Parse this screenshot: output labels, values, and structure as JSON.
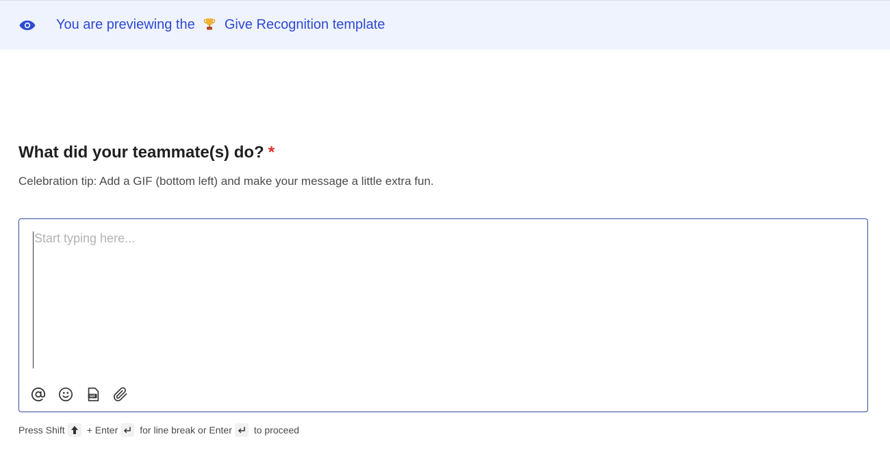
{
  "banner": {
    "prefix": "You are previewing the",
    "template_name": "Give Recognition template",
    "icon": "eye-icon",
    "trophy_icon": "trophy-icon"
  },
  "question": {
    "title": "What did your teammate(s) do?",
    "required_mark": "*",
    "hint": "Celebration tip: Add a GIF (bottom left) and make your message a little extra fun."
  },
  "editor": {
    "placeholder": "Start typing here...",
    "value": "",
    "toolbar": [
      {
        "name": "mention",
        "icon": "at-sign-icon"
      },
      {
        "name": "emoji",
        "icon": "smiley-icon"
      },
      {
        "name": "gif",
        "icon": "gif-icon"
      },
      {
        "name": "attachment",
        "icon": "paperclip-icon"
      }
    ]
  },
  "footer": {
    "press": "Press Shift",
    "plus_enter": "+ Enter",
    "line_break": "for line break or Enter",
    "proceed": "to proceed"
  },
  "colors": {
    "accent": "#2f49d1",
    "banner_bg": "#eef3fd",
    "required": "#e0312b",
    "editor_border": "#2f4a9e"
  }
}
